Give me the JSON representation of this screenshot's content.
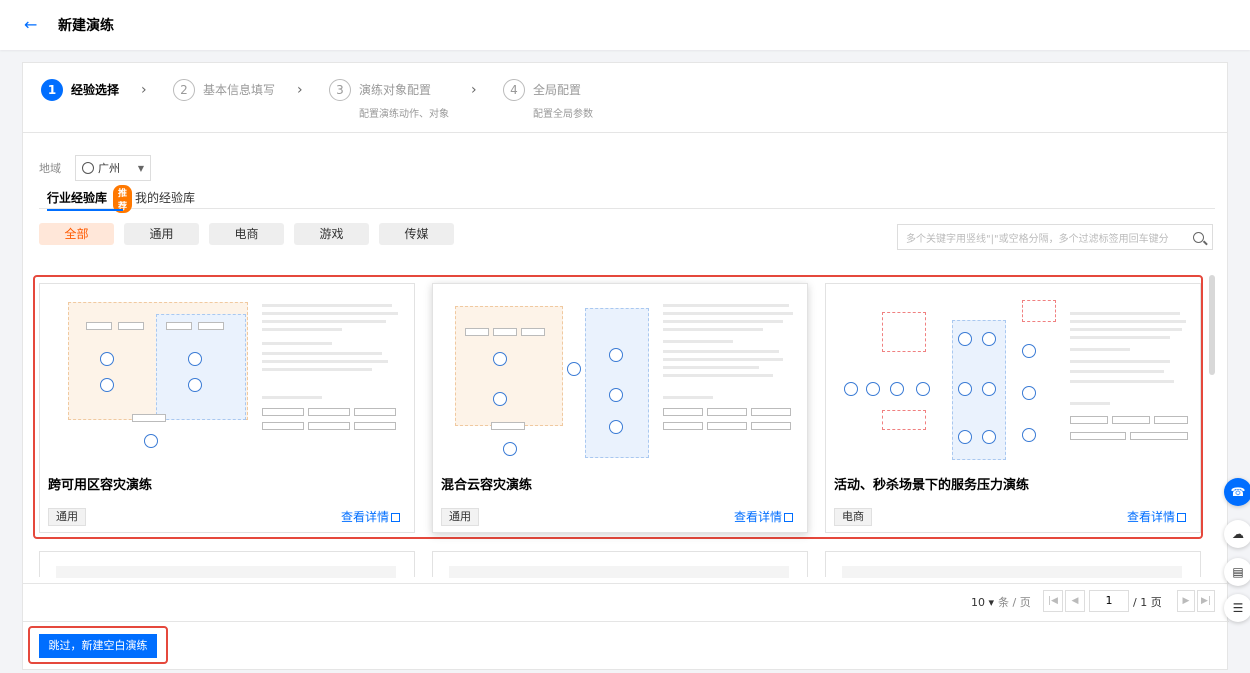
{
  "header": {
    "back_icon": "arrow-left-icon",
    "title": "新建演练"
  },
  "steps": [
    {
      "num": "1",
      "label": "经验选择",
      "sub": ""
    },
    {
      "num": "2",
      "label": "基本信息填写",
      "sub": ""
    },
    {
      "num": "3",
      "label": "演练对象配置",
      "sub": "配置演练动作、对象"
    },
    {
      "num": "4",
      "label": "全局配置",
      "sub": "配置全局参数"
    }
  ],
  "region": {
    "label": "地域",
    "value": "广州"
  },
  "library_tabs": {
    "industry": "行业经验库",
    "badge": "推荐",
    "mine": "我的经验库"
  },
  "categories": [
    "全部",
    "通用",
    "电商",
    "游戏",
    "传媒"
  ],
  "search": {
    "placeholder": "多个关键字用竖线\"|\"或空格分隔，多个过滤标签用回车键分"
  },
  "cards": [
    {
      "title": "跨可用区容灾演练",
      "tag": "通用",
      "detail": "查看详情"
    },
    {
      "title": "混合云容灾演练",
      "tag": "通用",
      "detail": "查看详情"
    },
    {
      "title": "活动、秒杀场景下的服务压力演练",
      "tag": "电商",
      "detail": "查看详情"
    }
  ],
  "pagination": {
    "page_size": "10",
    "unit": "条 / 页",
    "current": "1",
    "total": "/ 1 页"
  },
  "footer": {
    "skip_label": "跳过，新建空白演练"
  },
  "colors": {
    "primary": "#006eff",
    "highlight_border": "#e5483c",
    "active_category_bg": "#ffe7d9",
    "active_category_text": "#ff5a00"
  }
}
